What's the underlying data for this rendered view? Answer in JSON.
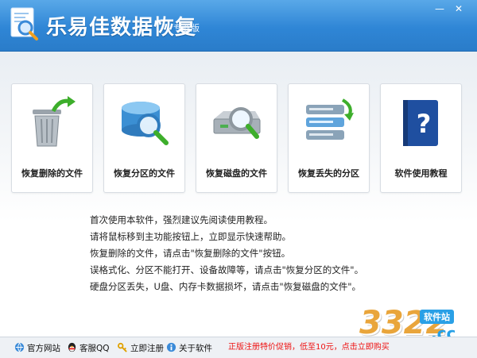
{
  "window": {
    "title": "乐易佳数据恢复",
    "edition": "专业版",
    "minimize_label": "—",
    "close_label": "✕"
  },
  "tiles": [
    {
      "label": "恢复删除的文件",
      "icon": "trash-can-restore-icon"
    },
    {
      "label": "恢复分区的文件",
      "icon": "disk-magnifier-icon"
    },
    {
      "label": "恢复磁盘的文件",
      "icon": "hard-drive-magnifier-icon"
    },
    {
      "label": "恢复丢失的分区",
      "icon": "stacked-partitions-arrow-icon"
    },
    {
      "label": "软件使用教程",
      "icon": "help-book-icon"
    }
  ],
  "tips": [
    "首次使用本软件，强烈建议先阅读使用教程。",
    "请将鼠标移到主功能按钮上，立即显示快速帮助。",
    "恢复删除的文件，请点击\"恢复删除的文件\"按钮。",
    "误格式化、分区不能打开、设备故障等，请点击\"恢复分区的文件\"。",
    "硬盘分区丢失，U盘、内存卡数据损坏，请点击\"恢复磁盘的文件\"。"
  ],
  "bottom": {
    "links": [
      {
        "label": "官方网站",
        "icon": "globe-icon"
      },
      {
        "label": "客服QQ",
        "icon": "qq-penguin-icon"
      },
      {
        "label": "立即注册",
        "icon": "key-icon"
      },
      {
        "label": "关于软件",
        "icon": "info-icon"
      }
    ],
    "promo": "正版注册特价促销，低至10元，点击立即购买",
    "watermark": {
      "number": "3322",
      "site": "软件站",
      "suffix": ".cc"
    }
  },
  "colors": {
    "titlebar": "#2f86d6",
    "promo_text": "#e11111",
    "accent_green": "#3dae2b",
    "accent_blue": "#2aa0e6"
  }
}
